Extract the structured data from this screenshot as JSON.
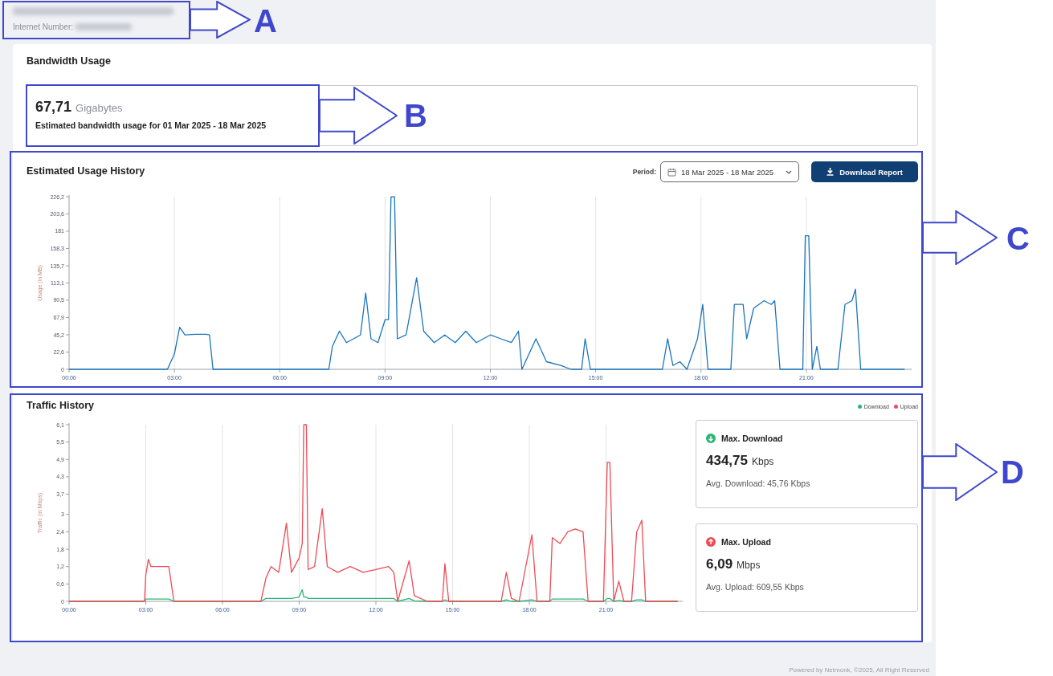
{
  "header": {
    "internet_number_label": "Internet Number:"
  },
  "bandwidth": {
    "title": "Bandwidth Usage",
    "total": "67,71",
    "unit": "Gigabytes",
    "description": "Estimated bandwidth usage for 01 Mar 2025 - 18 Mar 2025"
  },
  "usage_history": {
    "title": "Estimated Usage History",
    "period_label": "Period:",
    "period_value": "18 Mar 2025 - 18 Mar 2025",
    "download_button": "Download Report",
    "chart_data": {
      "type": "line",
      "grid": true,
      "ylabel": "Usage (in MB)",
      "xlim": [
        0,
        24
      ],
      "ylim": [
        0,
        226.2
      ],
      "xticks": [
        {
          "value": 0,
          "label": "00:00"
        },
        {
          "value": 3,
          "label": "03:00"
        },
        {
          "value": 6,
          "label": "06:00"
        },
        {
          "value": 9,
          "label": "09:00"
        },
        {
          "value": 12,
          "label": "12:00"
        },
        {
          "value": 15,
          "label": "15:00"
        },
        {
          "value": 18,
          "label": "18:00"
        },
        {
          "value": 21,
          "label": "21:00"
        }
      ],
      "yticks": [
        0,
        {
          "value": 22.6,
          "label": "22,6"
        },
        {
          "value": 45.2,
          "label": "45,2"
        },
        {
          "value": 67.9,
          "label": "67,9"
        },
        {
          "value": 90.5,
          "label": "90,5"
        },
        {
          "value": 113.1,
          "label": "113,1"
        },
        {
          "value": 135.7,
          "label": "135,7"
        },
        {
          "value": 158.3,
          "label": "158,3"
        },
        181,
        {
          "value": 203.6,
          "label": "203,6"
        },
        {
          "value": 226.2,
          "label": "226,2"
        }
      ],
      "x": [
        0,
        2.8,
        3.0,
        3.15,
        3.3,
        3.6,
        3.9,
        4.0,
        4.1,
        7.4,
        7.5,
        7.7,
        7.9,
        8.1,
        8.3,
        8.45,
        8.6,
        8.8,
        9.0,
        9.1,
        9.17,
        9.27,
        9.35,
        9.6,
        9.9,
        10.1,
        10.4,
        10.7,
        11.0,
        11.3,
        11.6,
        12.0,
        12.3,
        12.6,
        12.8,
        12.9,
        13.3,
        13.6,
        14.0,
        14.3,
        14.6,
        14.7,
        14.85,
        16.9,
        17.05,
        17.2,
        17.4,
        17.6,
        17.9,
        18.05,
        18.2,
        18.85,
        18.95,
        19.2,
        19.3,
        19.5,
        19.8,
        20.0,
        20.1,
        20.25,
        20.9,
        20.97,
        21.07,
        21.17,
        21.3,
        21.4,
        21.9,
        22.1,
        22.3,
        22.4,
        22.55,
        23.8
      ],
      "series": [
        {
          "color": "#1b75bb",
          "values": [
            0,
            0,
            20,
            55,
            45,
            46,
            46,
            45,
            0,
            0,
            30,
            50,
            35,
            40,
            45,
            100,
            40,
            35,
            65,
            65,
            226,
            226,
            40,
            45,
            120,
            50,
            35,
            45,
            35,
            50,
            35,
            45,
            40,
            35,
            50,
            0,
            40,
            10,
            5,
            0,
            0,
            40,
            0,
            0,
            40,
            5,
            10,
            0,
            40,
            85,
            0,
            0,
            85,
            85,
            40,
            80,
            90,
            85,
            90,
            0,
            0,
            175,
            175,
            0,
            30,
            0,
            0,
            85,
            90,
            105,
            0,
            0
          ]
        }
      ]
    }
  },
  "traffic_history": {
    "title": "Traffic History",
    "chart_data": {
      "type": "line",
      "grid": true,
      "ylabel": "Traffic (in Mbps)",
      "xlim": [
        0,
        24
      ],
      "ylim": [
        0,
        6.1
      ],
      "xticks": [
        {
          "value": 0,
          "label": "00:00"
        },
        {
          "value": 3,
          "label": "03:00"
        },
        {
          "value": 6,
          "label": "06:00"
        },
        {
          "value": 9,
          "label": "09:00"
        },
        {
          "value": 12,
          "label": "12:00"
        },
        {
          "value": 15,
          "label": "15:00"
        },
        {
          "value": 18,
          "label": "18:00"
        },
        {
          "value": 21,
          "label": "21:00"
        }
      ],
      "yticks": [
        0,
        {
          "value": 0.6,
          "label": "0,6"
        },
        {
          "value": 1.2,
          "label": "1,2"
        },
        {
          "value": 1.8,
          "label": "1,8"
        },
        {
          "value": 2.4,
          "label": "2,4"
        },
        3,
        {
          "value": 3.7,
          "label": "3,7"
        },
        {
          "value": 4.3,
          "label": "4,3"
        },
        {
          "value": 4.9,
          "label": "4,9"
        },
        {
          "value": 5.5,
          "label": "5,5"
        },
        {
          "value": 6.1,
          "label": "6,1"
        }
      ],
      "x": [
        0,
        2.95,
        3.0,
        3.1,
        3.2,
        3.9,
        4.1,
        7.5,
        7.7,
        7.9,
        8.2,
        8.5,
        8.7,
        9.0,
        9.12,
        9.18,
        9.28,
        9.35,
        9.6,
        9.9,
        10.1,
        10.5,
        11.0,
        11.5,
        12.0,
        12.5,
        12.7,
        12.85,
        13.3,
        13.5,
        14.0,
        14.6,
        14.7,
        14.85,
        16.9,
        17.1,
        17.3,
        17.6,
        18.1,
        18.3,
        18.8,
        18.9,
        19.2,
        19.5,
        19.8,
        20.1,
        20.3,
        20.9,
        21.05,
        21.15,
        21.3,
        21.5,
        21.7,
        22.0,
        22.2,
        22.4,
        22.55,
        23.8
      ],
      "series": [
        {
          "name": "Download",
          "color": "#2bb673",
          "values": [
            0,
            0,
            0.08,
            0.08,
            0.08,
            0.08,
            0,
            0,
            0.1,
            0.1,
            0.1,
            0.1,
            0.1,
            0.15,
            0.4,
            0.15,
            0.15,
            0.1,
            0.1,
            0.1,
            0.1,
            0.1,
            0.1,
            0.1,
            0.1,
            0.1,
            0.1,
            0,
            0.1,
            0.02,
            0,
            0,
            0.05,
            0,
            0,
            0.05,
            0,
            0,
            0.05,
            0,
            0,
            0.08,
            0.08,
            0.08,
            0.08,
            0.08,
            0,
            0,
            0.1,
            0.1,
            0,
            0.03,
            0,
            0,
            0.05,
            0.05,
            0,
            0
          ]
        },
        {
          "name": "Upload",
          "color": "#ee4b56",
          "values": [
            0,
            0,
            0.9,
            1.45,
            1.2,
            1.2,
            0,
            0,
            0.8,
            1.2,
            1.0,
            2.7,
            1.0,
            1.5,
            2.0,
            6.1,
            6.1,
            1.1,
            1.2,
            3.2,
            1.2,
            1.0,
            1.2,
            1.0,
            1.1,
            1.2,
            1.0,
            0,
            1.4,
            0.2,
            0,
            0,
            1.3,
            0,
            0,
            1.0,
            0.1,
            0,
            2.3,
            0,
            0,
            2.2,
            2.0,
            2.4,
            2.5,
            2.4,
            0,
            0,
            4.8,
            4.8,
            0,
            0.7,
            0,
            0,
            2.4,
            2.8,
            0,
            0
          ]
        }
      ]
    },
    "stats": [
      {
        "kind": "download",
        "color": "#2bb673",
        "title": "Max. Download",
        "value": "434,75",
        "unit": "Kbps",
        "average": "Avg. Download: 45,76 Kbps"
      },
      {
        "kind": "upload",
        "color": "#ee4b56",
        "title": "Max. Upload",
        "value": "6,09",
        "unit": "Mbps",
        "average": "Avg. Upload: 609,55 Kbps"
      }
    ]
  },
  "footer": "Powered by Netmonk, ©2025, All Right Reserved",
  "annotations": [
    {
      "label": "A"
    },
    {
      "label": "B"
    },
    {
      "label": "C"
    },
    {
      "label": "D"
    }
  ]
}
